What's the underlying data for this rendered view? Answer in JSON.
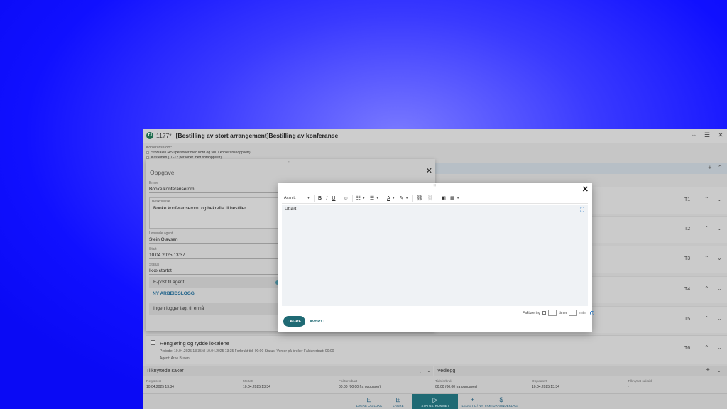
{
  "app": {
    "logo_text": "TJ",
    "case_number": "1177*",
    "case_title": "[Bestilling av stort arrangement]Bestilling av konferanse",
    "title_icons": [
      "collapse-icon",
      "menu-icon",
      "close-icon"
    ]
  },
  "konferanserom": {
    "label": "Konferanserom*",
    "options": [
      "Storsalen (450 personer med bord og 500 i konferanseoppsett)",
      "Kastelnen (10-12 personer med sofaoppsett)"
    ]
  },
  "oppgave_panel": {
    "title": "Oppgave",
    "emne_label": "Emne",
    "emne_value": "Booke konferanserom",
    "beskrivelse_label": "Beskrivelse",
    "beskrivelse_value": "Booke konferanserom, og bekrefte til bestiller.",
    "agent_label": "Løsende agent",
    "agent_value": "Stein Olavsen",
    "start_label": "Start",
    "start_value": "10.04.2025 13:37",
    "status_label": "Status",
    "status_value": "Ikke startet",
    "epost_label": "E-post til agent",
    "ny_arbeidslogg": "NY ARBEIDSLOGG",
    "ingen_logger": "Ingen logger lagt til ennå"
  },
  "task_rows": [
    {
      "label": "T1"
    },
    {
      "label": "T2"
    },
    {
      "label": "T3"
    },
    {
      "label": "T4"
    },
    {
      "label": "T5"
    }
  ],
  "task_t6": {
    "title": "Rengjøring og rydde lokalene",
    "meta": "Periode: 10.04.2025 13:35 til 10.04.2025 13:35   Forbrukt tid: 00:00   Status: Venter på bruker   Fakturerbart: 00:00",
    "agent": "Agent: Arne Busen",
    "label": "T6"
  },
  "tilknyttede": {
    "title": "Tilknyttede saker"
  },
  "vedlegg": {
    "title": "Vedlegg"
  },
  "info": [
    {
      "label": "Registrert",
      "value": "10.04.2025 13:34"
    },
    {
      "label": "Mottatt",
      "value": "10.04.2025 13:34"
    },
    {
      "label": "Fakturerbart",
      "value": "00:00 (00:00 fra oppgaver)"
    },
    {
      "label": "Tidsforbruk",
      "value": "00:00 (00:00 fra oppgaver)"
    },
    {
      "label": "Oppdatert",
      "value": "10.04.2025 13:34"
    },
    {
      "label": "Tilknyttet saksid",
      "value": "-"
    }
  ],
  "bottom_bar": [
    {
      "label": "LAGRE OG LUKK",
      "icon": "save-close-icon"
    },
    {
      "label": "LAGRE",
      "icon": "save-icon"
    },
    {
      "label": "STATUS: KOMMET",
      "icon": "play-icon"
    },
    {
      "label": "LEGG TIL / NY",
      "icon": "plus-icon"
    },
    {
      "label": "FAKTURAUNDERLAG",
      "icon": "dollar-icon"
    }
  ],
  "editor_modal": {
    "paragraph_select": "Avsnitt",
    "content": "Utført",
    "faktureringslabel": "Fakturering",
    "timer_label": "timer",
    "min_label": "min",
    "save_label": "LAGRE",
    "cancel_label": "AVBRYT",
    "colors": {
      "primary": "#1f6a74",
      "link": "#2a78c2"
    }
  }
}
